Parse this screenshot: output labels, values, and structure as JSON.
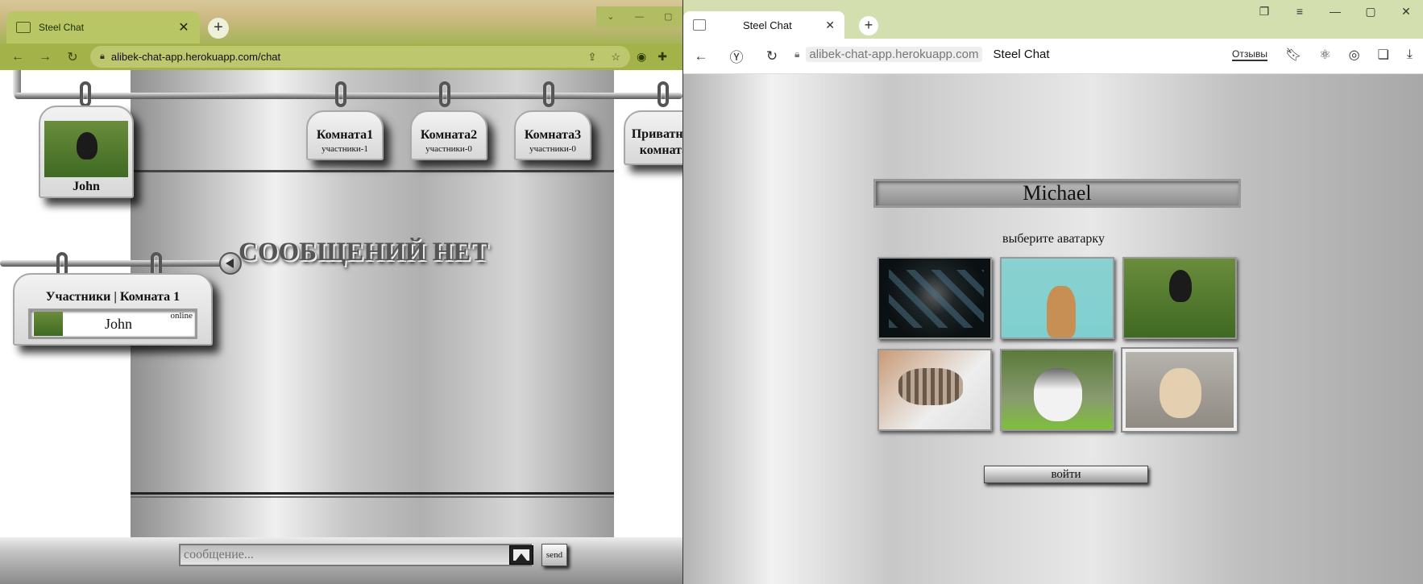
{
  "left_browser": {
    "tab_title": "Steel Chat",
    "url": "alibek-chat-app.herokuapp.com/chat",
    "page": {
      "user_tag": {
        "name": "John"
      },
      "rooms": [
        {
          "title": "Комната1",
          "members": "участники-1"
        },
        {
          "title": "Комната2",
          "members": "участники-0"
        },
        {
          "title": "Комната3",
          "members": "участники-0"
        }
      ],
      "private_room": {
        "title": "Приватная комната"
      },
      "no_messages": "СООБЩЕНИЙ НЕТ",
      "members_panel": {
        "title": "Участники | Комната 1",
        "member": {
          "name": "John",
          "status": "online"
        }
      },
      "composer": {
        "placeholder": "сообщение...",
        "send_label": "send"
      }
    }
  },
  "right_browser": {
    "tab_title": "Steel Chat",
    "url": "alibek-chat-app.herokuapp.com",
    "page_title": "Steel Chat",
    "reviews_label": "Отзывы",
    "page": {
      "name_value": "Michael",
      "choose_avatar": "выберите аватарку",
      "login_label": "войти",
      "avatars": [
        {
          "subject": "raccoon-in-leaves",
          "selected": false
        },
        {
          "subject": "kitten-waving",
          "selected": false
        },
        {
          "subject": "kitten-on-grass",
          "selected": false
        },
        {
          "subject": "tabby-kitten-lying",
          "selected": false
        },
        {
          "subject": "husky-puppy",
          "selected": false
        },
        {
          "subject": "fluffy-puppy",
          "selected": true
        }
      ]
    }
  },
  "colors": {
    "left_theme": "#a4b24a",
    "right_tabbar": "#d3dfae",
    "steel_light": "#f0f0f0",
    "steel_dark": "#8f8f8f"
  }
}
